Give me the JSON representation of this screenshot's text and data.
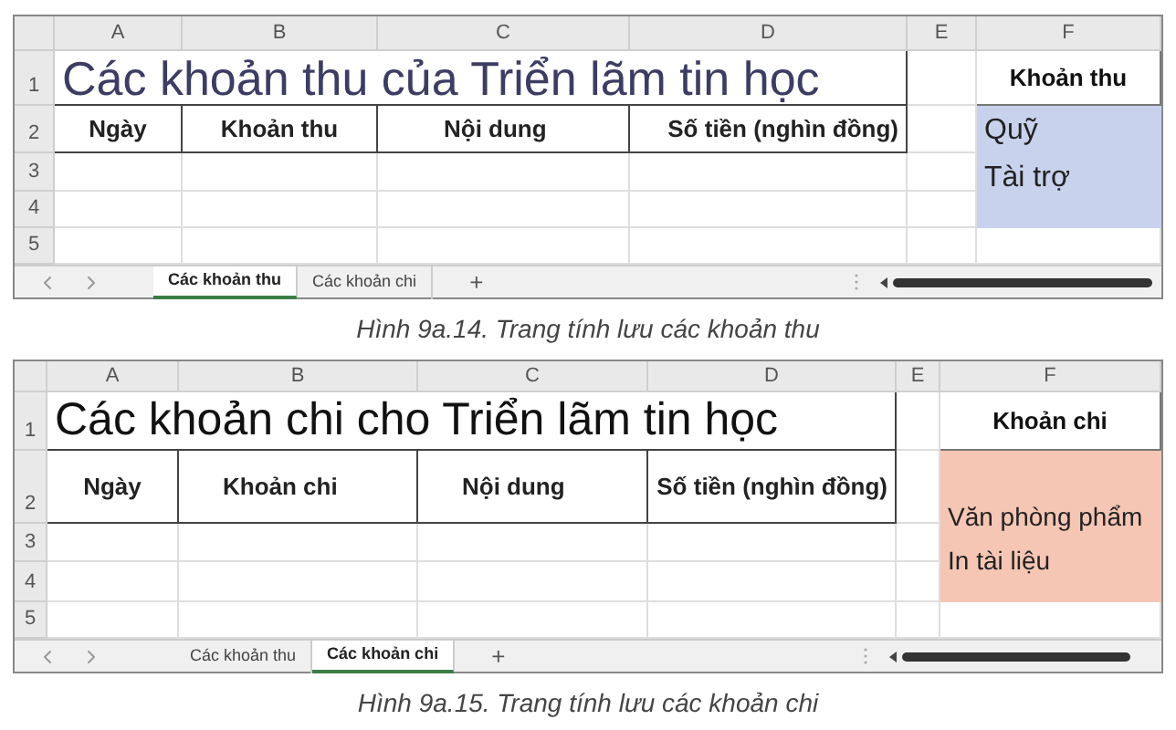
{
  "sheets": [
    {
      "column_headers": [
        "A",
        "B",
        "C",
        "D",
        "E",
        "F"
      ],
      "row_headers": [
        "1",
        "2",
        "3",
        "4",
        "5"
      ],
      "title": "Các khoản thu của Triển lãm tin học",
      "headers": [
        "Ngày",
        "Khoản thu",
        "Nội dung",
        "Số tiền (nghìn đồng)"
      ],
      "side_table": {
        "header": "Khoản thu",
        "color": "#c8d2ec",
        "items": [
          "Quỹ",
          "Tài trợ"
        ]
      },
      "tabs": [
        {
          "label": "Các khoản thu",
          "selected": true
        },
        {
          "label": "Các khoản chi",
          "selected": false
        }
      ],
      "add_tab": "+",
      "caption": "Hình 9a.14. Trang tính lưu các khoản thu"
    },
    {
      "column_headers": [
        "A",
        "B",
        "C",
        "D",
        "E",
        "F"
      ],
      "row_headers": [
        "1",
        "2",
        "3",
        "4",
        "5"
      ],
      "title": "Các khoản chi cho Triển lãm tin học",
      "headers": [
        "Ngày",
        "Khoản chi",
        "Nội dung",
        "Số tiền (nghìn đồng)"
      ],
      "side_table": {
        "header": "Khoản chi",
        "color": "#f5c6b4",
        "items": [
          "Văn phòng phẩm",
          "In tài liệu"
        ]
      },
      "tabs": [
        {
          "label": "Các khoản thu",
          "selected": false
        },
        {
          "label": "Các khoản chi",
          "selected": true
        }
      ],
      "add_tab": "+",
      "caption": "Hình 9a.15. Trang tính lưu các khoản chi"
    }
  ]
}
